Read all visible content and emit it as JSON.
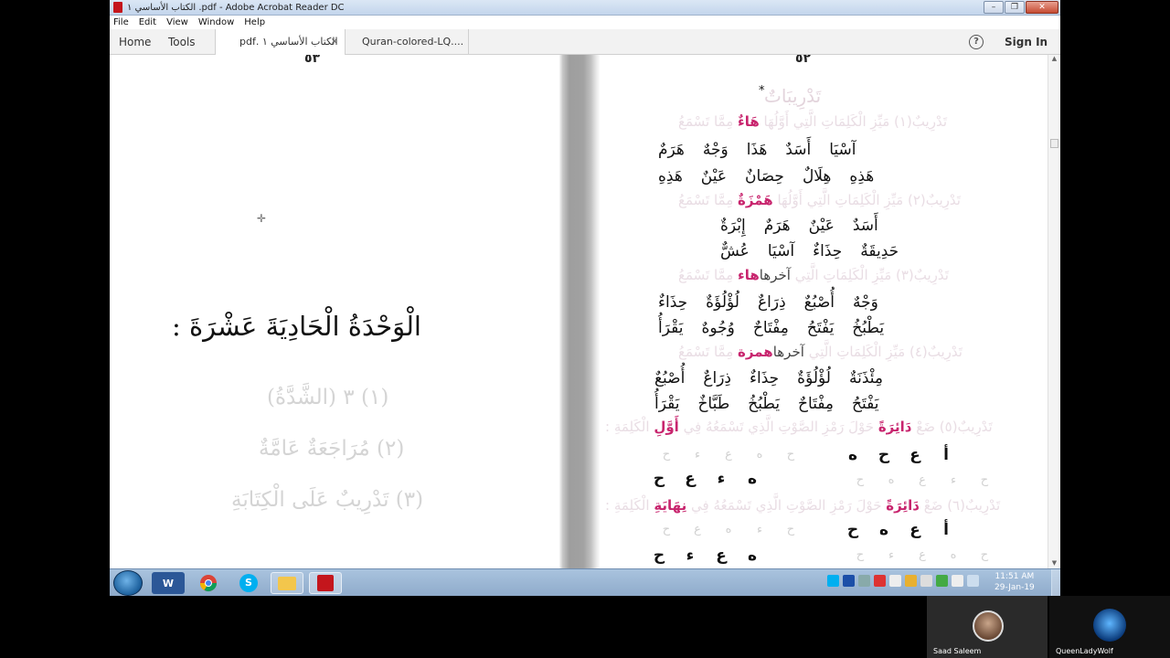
{
  "window": {
    "title": "الكتاب الأساسي ١ .pdf - Adobe Acrobat Reader DC"
  },
  "menu": [
    "File",
    "Edit",
    "View",
    "Window",
    "Help"
  ],
  "toolbar": {
    "home": "Home",
    "tools": "Tools",
    "help_glyph": "?",
    "sign_in": "Sign In"
  },
  "tabs": [
    {
      "label": "الكتاب الأساسي ١ .pdf",
      "close": "×"
    },
    {
      "label": "Quran-colored-LQ...."
    }
  ],
  "left_page": {
    "page_number": "٥٣",
    "unit_title": "الْوَحْدَةُ الْحَادِيَةَ عَشْرَةَ :",
    "lessons": [
      "(١) ٣ (الشَّدَّةُ)",
      "(٢) مُرَاجَعَةٌ عَامَّةٌ",
      "(٣) تَدْرِيبٌ عَلَى الْكِتَابَةِ"
    ]
  },
  "right_page": {
    "page_number": "٥٢",
    "star": "*",
    "heading": "تَدْرِيبَاتٌ",
    "ex1": {
      "pre": "تَدْرِيبٌ(١) مَيِّزِ الْكَلِمَاتِ الَّتِي أَوَّلُهَا",
      "pink": "هَاءٌ",
      "post": "مِمَّا تَسْمَعُ"
    },
    "ex1_rows": [
      [
        "هَرَمٌ",
        "وَجْهٌ",
        "هَذَا",
        "أَسَدٌ",
        "آسْيَا"
      ],
      [
        "هَذِهِ",
        "عَيْنٌ",
        "حِصَانٌ",
        "هِلَالٌ",
        "هَذِهِ"
      ]
    ],
    "ex2": {
      "pre": "تَدْرِيبٌ(٢) مَيِّزِ الْكَلِمَاتِ الَّتِي أَوَّلُهَا",
      "pink": "هَمْزَةٌ",
      "post": "مِمَّا تَسْمَعُ"
    },
    "ex2_rows": [
      [
        "إِبْرَةٌ",
        "هَرَمٌ",
        "عَيْنٌ",
        "أَسَدٌ"
      ],
      [
        "عُشٌّ",
        "آسْيَا",
        "حِذَاءٌ",
        "حَدِيقَةٌ"
      ]
    ],
    "ex3": {
      "pre": "تَدْرِيبٌ(٣) مَيِّزِ الْكَلِمَاتِ الَّتِي",
      "dark": "آخرها",
      "pink": "هاء",
      "post": "مِمَّا تَسْمَعُ"
    },
    "ex3_rows": [
      [
        "حِذَاءٌ",
        "لُؤْلُؤَةٌ",
        "ذِرَاعٌ",
        "أُصْبُعٌ",
        "وَجْهٌ"
      ],
      [
        "يَقْرَأُ",
        "وُجُوهٌ",
        "مِفْتَاحٌ",
        "يَفْتَحُ",
        "يَطْبُخُ"
      ]
    ],
    "ex4": {
      "pre": "تَدْرِيبٌ(٤) مَيِّزِ الْكَلِمَاتِ الَّتِي",
      "dark": "آخرها",
      "pink": "همزة",
      "post": "مِمَّا تَسْمَعُ"
    },
    "ex4_rows": [
      [
        "أُصْبُعٌ",
        "ذِرَاعٌ",
        "حِذَاءٌ",
        "لُؤْلُؤَةٌ",
        "مِئْذَنَةٌ"
      ],
      [
        "يَقْرَأُ",
        "طَبَّاخٌ",
        "يَطْبُخُ",
        "مِفْتَاحٌ",
        "يَفْتَحُ"
      ]
    ],
    "ex5": {
      "pre": "تَدْرِيبٌ(٥) ضَعْ",
      "pink": "دَائِرَةً",
      "mid": "حَوْلَ رَمْزِ الصَّوْتِ الَّذِي تَسْمَعُهُ فِي",
      "pink2": "أَوَّلِ",
      "post": "الْكَلِمَةِ :"
    },
    "ex5_rows": [
      [
        "ه",
        "ح",
        "ع",
        "أ"
      ],
      [
        "ح",
        "ع",
        "ء",
        "ه"
      ]
    ],
    "ex5_ghost": [
      [
        "ح",
        "ء",
        "ع",
        "ه",
        "ح"
      ],
      [
        "ح",
        "ه",
        "ع",
        "ء",
        "ح"
      ]
    ],
    "ex6": {
      "pre": "تَدْرِيبٌ(٦) ضَعْ",
      "pink": "دَائِرَةً",
      "mid": "حَوْلَ رَمْزِ الصَّوْتِ الَّذِي تَسْمَعُهُ فِي",
      "pink2": "نِهَايَةِ",
      "post": "الْكَلِمَةِ :"
    },
    "ex6_rows": [
      [
        "ح",
        "ه",
        "ع",
        "أ"
      ],
      [
        "ح",
        "ء",
        "ع",
        "ه"
      ]
    ],
    "ex6_ghost": [
      [
        "ح",
        "ع",
        "ه",
        "ء",
        "ح"
      ],
      [
        "ح",
        "ء",
        "ع",
        "ه",
        "ح"
      ]
    ]
  },
  "taskbar": {
    "clock_time": "11:51 AM",
    "clock_date": "29-Jan-19",
    "word_glyph": "W",
    "skype_glyph": "S"
  },
  "participants": [
    {
      "name": "Saad Saleem"
    },
    {
      "name": "QueenLadyWolf"
    }
  ]
}
